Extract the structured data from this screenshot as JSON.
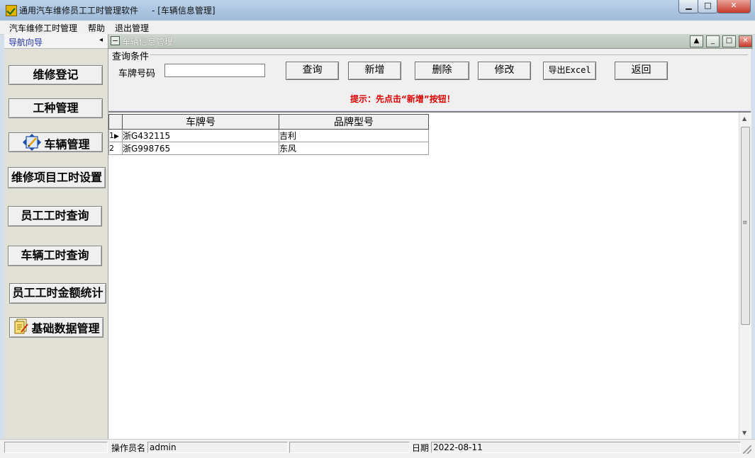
{
  "window": {
    "title": "通用汽车维修员工工时管理软件     - [车辆信息管理]",
    "controls": {
      "minimize": "▁",
      "maximize": "□",
      "close": "✕"
    }
  },
  "menu": [
    "汽车维修工时管理",
    "帮助",
    "退出管理"
  ],
  "sidebar": {
    "title": "导航向导",
    "collapse_glyph": "◂",
    "items": [
      {
        "label": "维修登记",
        "icon": ""
      },
      {
        "label": "工种管理",
        "icon": ""
      },
      {
        "label": "车辆管理",
        "icon": "vehicle-edit-icon"
      },
      {
        "label": "维修项目工时设置",
        "icon": ""
      },
      {
        "label": "员工工时查询",
        "icon": ""
      },
      {
        "label": "车辆工时查询",
        "icon": ""
      },
      {
        "label": "员工工时金额统计",
        "icon": ""
      },
      {
        "label": "基础数据管理",
        "icon": "document-stack-icon"
      }
    ]
  },
  "child_window": {
    "title": "车辆信息管理",
    "controls": {
      "restore": "▲",
      "minimize": "_",
      "maximize": "□",
      "close": "✕"
    }
  },
  "query": {
    "legend": "查询条件",
    "plate_label": "车牌号码",
    "plate_value": "",
    "buttons": {
      "search": "查询",
      "add": "新增",
      "delete": "删除",
      "edit": "修改",
      "export": "导出Excel",
      "back": "返回"
    },
    "hint": "提示：先点击“新增”按钮！"
  },
  "grid": {
    "columns": [
      "车牌号",
      "品牌型号"
    ],
    "rows": [
      {
        "num": "1",
        "plate": "浙G432115",
        "brand": "吉利"
      },
      {
        "num": "2",
        "plate": "浙G998765",
        "brand": "东风"
      }
    ],
    "current_row_marker": "▶",
    "scroll_up": "▲",
    "scroll_down": "▼",
    "scroll_grip": "≡"
  },
  "status": {
    "operator_label": "操作员名",
    "operator_value": "admin",
    "date_label": "日期",
    "date_value": "2022-08-11"
  },
  "colors": {
    "hint": "#e00000",
    "sidebar_title": "#1c2fa8",
    "sidebar_bg": "#e2e1d8"
  }
}
